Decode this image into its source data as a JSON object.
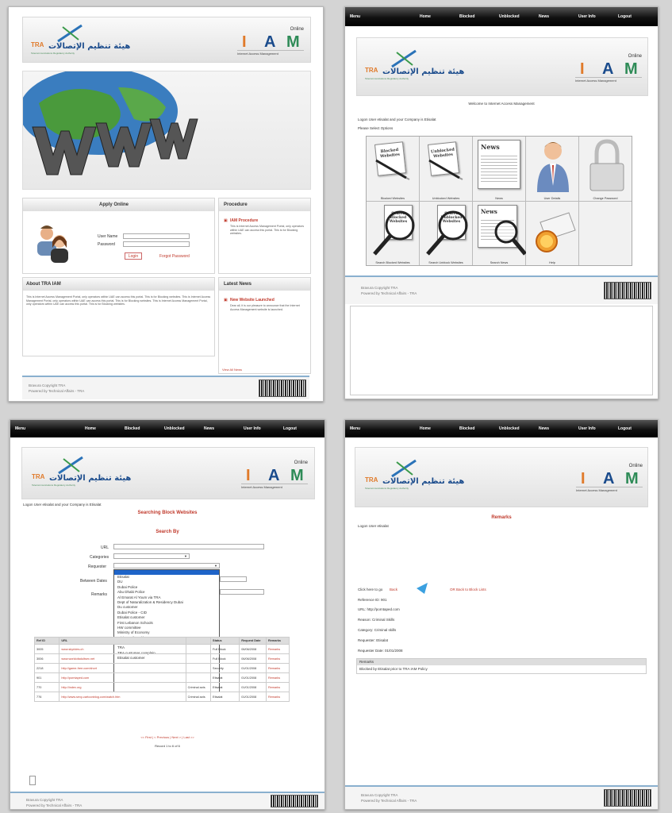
{
  "nav": {
    "menu": "Menu",
    "home": "Home",
    "blocked": "Blocked",
    "unblocked": "Unblocked",
    "news": "News",
    "user_info": "User Info",
    "logout": "Logout"
  },
  "brand": {
    "tra": "TRA",
    "arabic": "هيئة تنظيم الإتصالات",
    "tra_sub": "Telecommunications Regulatory Authority",
    "online": "Online",
    "iam_i": "I",
    "iam_a": "A",
    "iam_m": "M",
    "iam_caption": "Internet Access Management",
    "colors": {
      "i": "#e07a2a",
      "a": "#1a4b8c",
      "m": "#2e8b57"
    }
  },
  "footer": {
    "copyright": "Bravura Copyright TRA",
    "powered": "Powered by Technical Affairs - TRA"
  },
  "login_page": {
    "apply_online": "Apply Online",
    "user_name": "User Name",
    "password": "Password",
    "login_btn": "Login",
    "forgot": "Forgot Password",
    "procedure": "Procedure",
    "iam_procedure": "IAM Procedure",
    "procedure_text": "This is Internet Access Management Portal, only operators within UAE can access this portal. This is for Blocking websites.",
    "about": "About TRA IAM",
    "about_text": "This is Internet Access Management Portal, only operators within UAE can access this portal. This is for Blocking websites. This is Internet Access Management Portal, only operators within UAE can access this portal. This is for Blocking websites. This is Internet Access Management Portal, only operators within UAE can access this portal. This is for Blocking websites.",
    "latest_news": "Latest News",
    "news_title": "New Website Launched",
    "news_text": "Dear all, it is our pleasure to announce that the Internet Access Management website is launched.",
    "view_all": "View All News"
  },
  "home_page": {
    "welcome": "Welcome to Internet Access Management",
    "logon_line": "Logon User etisalat and your Company is Etisalat",
    "select": "Please Select Options",
    "tiles": [
      "Blocked Websites",
      "Unblocked Websites",
      "News",
      "User Details",
      "Change Password",
      "Search Blocked Websites",
      "Search Unblock Websites",
      "Search News",
      "Help"
    ],
    "doc_blocked": "Blocked Websites",
    "doc_unblocked": "Unblocked Websites",
    "news_word": "News",
    "lens_blocked": "Search Blocked Websites",
    "lens_unblocked": "Search Unblocked Websites"
  },
  "search_page": {
    "logon_line": "Logon User etisalat and your Company is Etisalat",
    "title": "Searching Block Websites",
    "search_by": "Search By",
    "url": "URL",
    "category": "Categories",
    "requester": "Requester",
    "between": "Between Dates",
    "remarks": "Remarks",
    "options": [
      "Etisalat",
      "DU",
      "Dubai Police",
      "Abu Dhabi Police",
      "Al Emarat Al Youm via TRA",
      "Dept of Naturalization & Residency Dubai",
      "Du customer",
      "Dubai Police - CID",
      "Etisalat customer",
      "First Lebanon Schools",
      "HW committee",
      "Ministry of Economy",
      "Ministry of Health",
      "State Security",
      "TRA",
      "TRA customer complain",
      "Etisalat customer"
    ],
    "headers": [
      "Ref ID",
      "URL",
      "",
      "Status",
      "Request Date",
      "Remarks"
    ],
    "rows": [
      [
        "3005",
        "www.skyrides.ch",
        "",
        "Full Block",
        "06/06/2008",
        "Remarks"
      ],
      [
        "3006",
        "www.worldofadultsex.net",
        "",
        "Full Block",
        "06/06/2008",
        "Remarks"
      ],
      [
        "2218",
        "http://game-free.com/short",
        "",
        "Security",
        "01/01/2008",
        "Remarks"
      ],
      [
        "901",
        "http://porntaped.com",
        "",
        "Etisalat",
        "01/01/2008",
        "Remarks"
      ],
      [
        "770",
        "http://index.org",
        "Criminal acts",
        "Etisalat",
        "01/01/2008",
        "Remarks"
      ],
      [
        "776",
        "http://www.sexy-cartoonblog.com/watch.htm",
        "Criminal acts",
        "Etisalat",
        "01/01/2008",
        "Remarks"
      ]
    ],
    "pager": "<< First | < Previous | Next > | Last >>",
    "page_info": "Record 1 to 6 of 6"
  },
  "remarks_page": {
    "title": "Remarks",
    "logon_line": "Logon User etisalat",
    "click_here": "Click here to go",
    "back": "Back",
    "or_back": "OR  Back to Block Lists",
    "reference": "Reference ID: 901",
    "url": "URL: http://porntaped.com",
    "reason": "Reason: Criminal Skills",
    "category": "Category: Criminal skills",
    "requester": "Requester: Etisalat",
    "request_date": "Requester Date: 01/01/2008",
    "remarks_head": "Remarks",
    "remarks_text": "Blocked by Etisalat prior to TRA IAM Policy"
  }
}
